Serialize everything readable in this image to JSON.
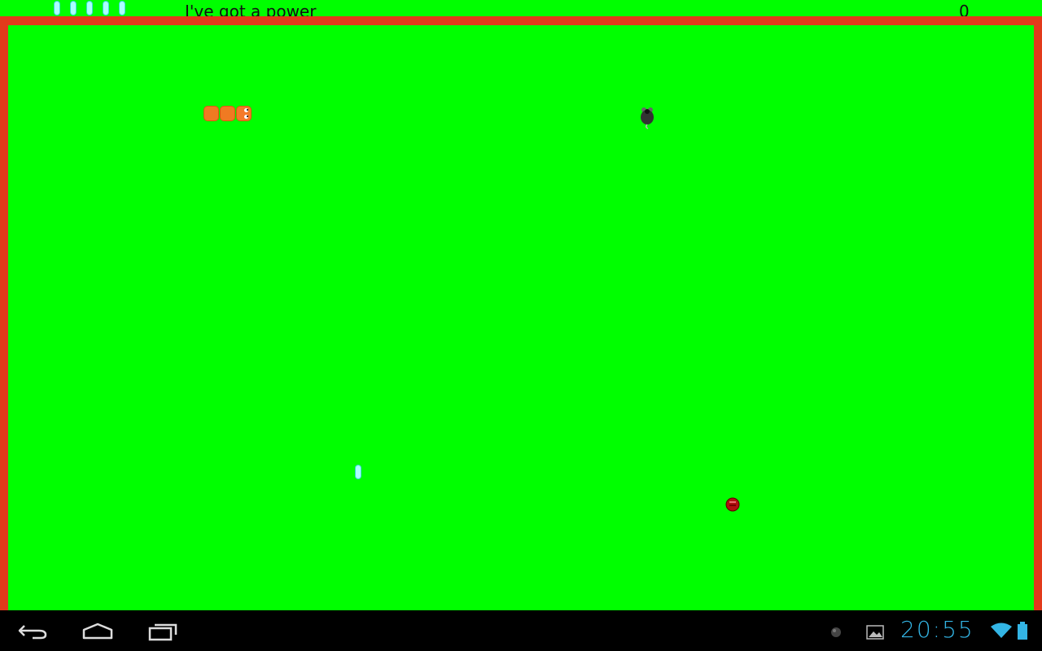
{
  "hud": {
    "power_pills_count": 5,
    "message": "I've got a power",
    "score": "0"
  },
  "game": {
    "snake_length": 3,
    "snake_direction": "right",
    "items": [
      "mouse",
      "power-pill",
      "red-orb"
    ]
  },
  "colors": {
    "field": "#00ff00",
    "wall": "#e23a1b",
    "snake": "#f07a22",
    "pill": "#aaffff",
    "navbar": "#000000",
    "clock": "#33b5e5"
  },
  "status_bar": {
    "time": "20:55"
  },
  "nav": {
    "back_icon": "back-icon",
    "home_icon": "home-icon",
    "recents_icon": "recents-icon"
  }
}
